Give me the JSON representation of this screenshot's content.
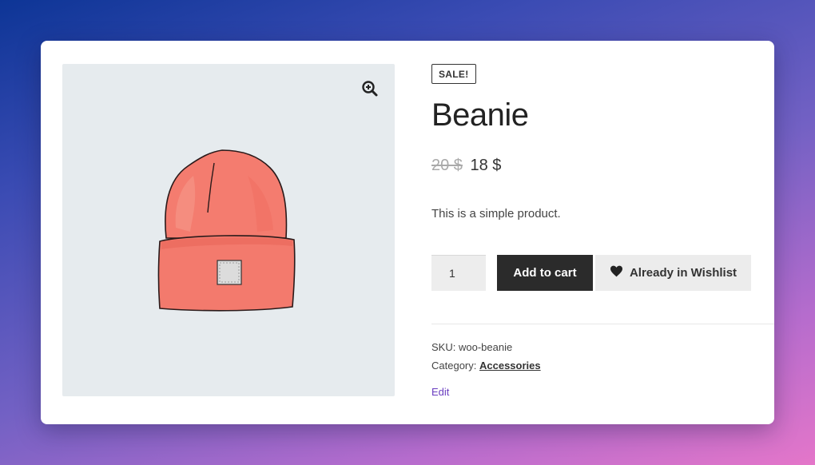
{
  "product": {
    "badge": "SALE!",
    "title": "Beanie",
    "old_price": "20 $",
    "price": "18 $",
    "description": "This is a simple product.",
    "quantity": "1",
    "add_to_cart_label": "Add to cart",
    "wishlist_label": "Already in Wishlist",
    "sku_label": "SKU:",
    "sku_value": "woo-beanie",
    "category_label": "Category:",
    "category_value": "Accessories",
    "edit_label": "Edit"
  },
  "icons": {
    "zoom": "zoom-in-icon",
    "wishlist": "heart-icon"
  },
  "colors": {
    "add_to_cart_bg": "#2b2b2b",
    "wishlist_bg": "#ececec",
    "gallery_bg": "#e6ebee",
    "beanie": "#f2776a",
    "edit_link": "#6a3ec0"
  }
}
